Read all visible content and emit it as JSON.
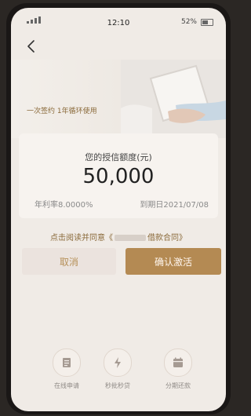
{
  "status_bar": {
    "time": "12:10",
    "battery_text": "52%"
  },
  "hero": {
    "slogan": "一次签约 1年循环使用"
  },
  "credit": {
    "label": "您的授信额度(元)",
    "amount": "50,000",
    "rate": "年利率8.0000%",
    "due_date": "到期日2021/07/08"
  },
  "agreement": {
    "prefix": "点击阅读并同意《",
    "suffix": "借款合同》"
  },
  "buttons": {
    "cancel": "取消",
    "confirm": "确认激活"
  },
  "features": [
    {
      "label": "在线申请",
      "icon": "document-icon"
    },
    {
      "label": "秒批秒贷",
      "icon": "lightning-icon"
    },
    {
      "label": "分期还款",
      "icon": "calendar-icon"
    }
  ]
}
